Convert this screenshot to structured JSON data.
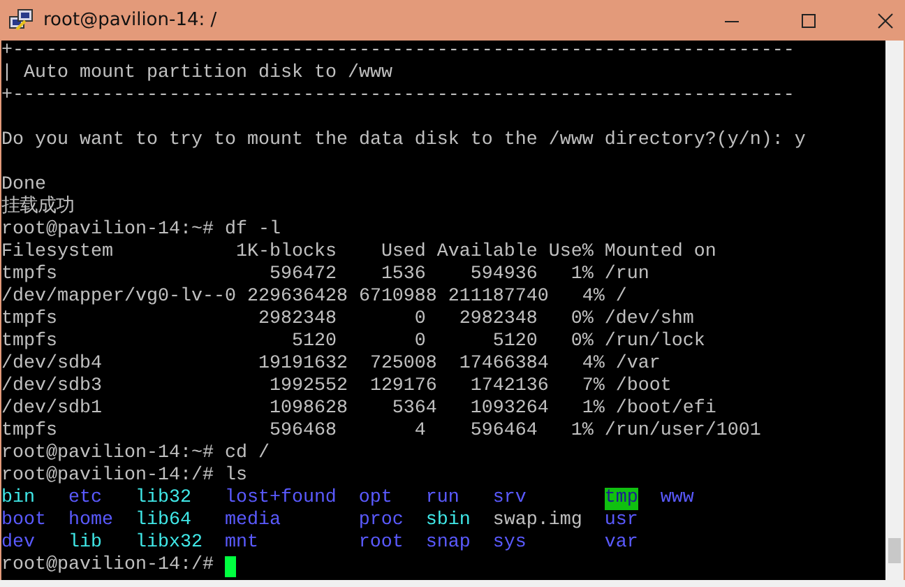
{
  "window": {
    "title": "root@pavilion-14: /"
  },
  "terminal": {
    "blocks": [
      [
        "+----------------------------------------------------------------------",
        "| Auto mount partition disk to /www",
        "+----------------------------------------------------------------------"
      ],
      [
        "Do you want to try to mount the data disk to the /www directory?(y/n): y"
      ],
      [
        "Done",
        "挂载成功",
        "root@pavilion-14:~# df -l",
        "Filesystem           1K-blocks    Used Available Use% Mounted on",
        "tmpfs                   596472    1536    594936   1% /run",
        "/dev/mapper/vg0-lv--0 229636428 6710988 211187740   4% /",
        "tmpfs                  2982348       0   2982348   0% /dev/shm",
        "tmpfs                     5120       0      5120   0% /run/lock",
        "/dev/sdb4              19191632  725008  17466384   4% /var",
        "/dev/sdb3               1992552  129176   1742136   7% /boot",
        "/dev/sdb1               1098628    5364   1093264   1% /boot/efi",
        "tmpfs                   596468       4    596464   1% /run/user/1001",
        "root@pavilion-14:~# cd /",
        "root@pavilion-14:/# ls"
      ]
    ],
    "ls_rows": [
      [
        {
          "name": "bin",
          "kind": "link"
        },
        {
          "name": "etc",
          "kind": "dir"
        },
        {
          "name": "lib32",
          "kind": "link"
        },
        {
          "name": "lost+found",
          "kind": "dir"
        },
        {
          "name": "opt",
          "kind": "dir"
        },
        {
          "name": "run",
          "kind": "dir"
        },
        {
          "name": "srv",
          "kind": "dir"
        },
        {
          "name": "tmp",
          "kind": "sticky"
        },
        {
          "name": "www",
          "kind": "dir"
        }
      ],
      [
        {
          "name": "boot",
          "kind": "dir"
        },
        {
          "name": "home",
          "kind": "dir"
        },
        {
          "name": "lib64",
          "kind": "link"
        },
        {
          "name": "media",
          "kind": "dir"
        },
        {
          "name": "proc",
          "kind": "dir"
        },
        {
          "name": "sbin",
          "kind": "link"
        },
        {
          "name": "swap.img",
          "kind": "file"
        },
        {
          "name": "usr",
          "kind": "dir"
        }
      ],
      [
        {
          "name": "dev",
          "kind": "dir"
        },
        {
          "name": "lib",
          "kind": "link"
        },
        {
          "name": "libx32",
          "kind": "link"
        },
        {
          "name": "mnt",
          "kind": "dir"
        },
        {
          "name": "root",
          "kind": "dir"
        },
        {
          "name": "snap",
          "kind": "dir"
        },
        {
          "name": "sys",
          "kind": "dir"
        },
        {
          "name": "var",
          "kind": "dir"
        }
      ]
    ],
    "final_prompt": "root@pavilion-14:/# "
  }
}
